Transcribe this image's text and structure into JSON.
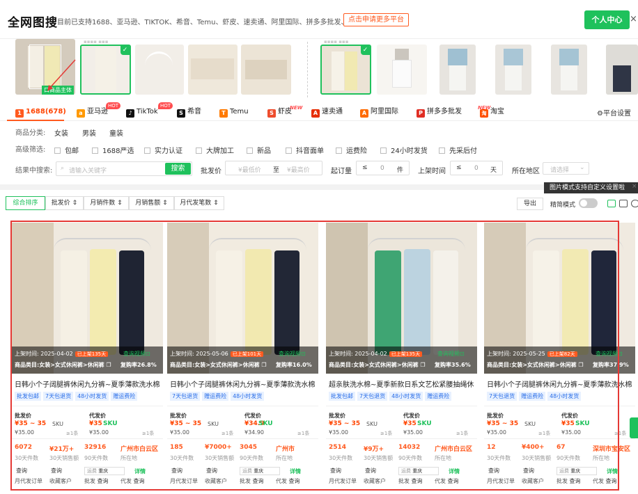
{
  "header": {
    "logo": "全网图搜",
    "supported": "目前已支持1688、亚马逊、TIKTOK、希音、Temu、虾皮、速卖通、阿里国际、拼多多批发、淘宝",
    "apply_label": "点击申请更多平台",
    "user_center": "个人中心",
    "close": "×",
    "main_badge": "口商品主体"
  },
  "platform_tabs": [
    {
      "label": "1688(678)",
      "color": "#ff5a1f",
      "glyph": "1"
    },
    {
      "label": "亚马逊",
      "color": "#ff9900",
      "glyph": "a",
      "badge": "HOT"
    },
    {
      "label": "TikTok",
      "color": "#111111",
      "glyph": "♪",
      "badge": "HOT"
    },
    {
      "label": "希音",
      "color": "#111111",
      "glyph": "S"
    },
    {
      "label": "Temu",
      "color": "#ff7a00",
      "glyph": "T"
    },
    {
      "label": "虾皮",
      "color": "#ee4d2d",
      "glyph": "S",
      "badge": "NEW"
    },
    {
      "label": "速卖通",
      "color": "#e62e04",
      "glyph": "A"
    },
    {
      "label": "阿里国际",
      "color": "#ff6a00",
      "glyph": "A"
    },
    {
      "label": "拼多多批发",
      "color": "#e02e24",
      "glyph": "P",
      "badge": "NEW"
    },
    {
      "label": "淘宝",
      "color": "#ff5000",
      "glyph": "淘"
    }
  ],
  "platform_settings": "平台设置",
  "filters": {
    "category_label": "商品分类:",
    "categories": [
      "女装",
      "男装",
      "童装"
    ],
    "advanced_label": "高级筛选:",
    "advanced": [
      "包邮",
      "1688严选",
      "实力认证",
      "大牌加工",
      "新品",
      "抖音面单",
      "运费险",
      "24小时发货",
      "先采后付"
    ],
    "search_in_label": "结果中搜索:",
    "search_placeholder": "请输入关键字",
    "search_button": "搜索",
    "wholesale_price_label": "批发价",
    "min_price_ph": "¥最低价",
    "to": "至",
    "max_price_ph": "¥最高价",
    "moq_label": "起订量",
    "le": "≤",
    "moq_value": "0",
    "moq_unit": "件",
    "shelf_time_label": "上架时间",
    "shelf_value": "0",
    "shelf_unit": "天",
    "region_label": "所在地区",
    "region_ph": "请选择"
  },
  "sort": {
    "buttons": [
      "综合排序",
      "批发价 ⇕",
      "月销件数 ⇕",
      "月销售额 ⇕",
      "月代发笔数 ⇕"
    ],
    "tip": "图片模式支持自定义设置啦",
    "tip_close": "×",
    "export": "导出",
    "simple_mode": "精简模式"
  },
  "card_labels": {
    "shelf_time": "上架时间:",
    "category": "商品类目:",
    "video": "查询视频⊡",
    "wholesale": "批发价",
    "dropship": "代发价",
    "sku": "SKU",
    "sales30": "30天件数",
    "sales30_amount": "30天销售额",
    "sales90": "90天件数",
    "location": "所在地",
    "query": "查询",
    "shipping": "运费",
    "details": "详情",
    "monthly_orders": "月代发订单",
    "collect": "收藏客户",
    "wholesale_short": "批发",
    "dropship_short": "代发",
    "query2": "查询"
  },
  "products": [
    {
      "date": "2025-04-02",
      "shelf_days": "已上架135天",
      "category": "女装>女式休闲裤>休闲裤",
      "repurchase": "复购率26.8%",
      "title": "日韩小个子阔腿裤休闲九分裤~夏季薄款洗水棉...",
      "tags": [
        "批发包邮",
        "7天包退货",
        "48小时发货",
        "赠运费险"
      ],
      "w_price": "¥35 ~ 35",
      "w_base": "¥35.00",
      "w_moq": "≥1条",
      "d_price": "¥35",
      "d_base": "¥35.00",
      "d_moq": "≥1条",
      "s30": "6072",
      "s30amt": "¥21万+",
      "s90": "32916",
      "loc": "广州市白云区",
      "ship_city": "重庆",
      "img_colors": [
        "#efe9df",
        "#d9cdb8",
        "#f5f0e4",
        "#f3ebb0",
        "#1f2433"
      ]
    },
    {
      "date": "2025-05-06",
      "shelf_days": "已上架101天",
      "category": "女装>女式休闲裤>休闲裤",
      "repurchase": "复购率16.0%",
      "title": "日韩小个子阔腿裤休闲九分裤~夏季薄款洗水棉...",
      "tags": [
        "7天包退货",
        "赠运费险",
        "48小时发货"
      ],
      "w_price": "¥35 ~ 35",
      "w_base": "¥35.00",
      "w_moq": "≥1条",
      "d_price": "¥34.9",
      "d_base": "¥34.90",
      "d_moq": "≥1条",
      "s30": "185",
      "s30amt": "¥7000+",
      "s90": "3045",
      "loc": "广州市",
      "ship_city": "重庆",
      "img_colors": [
        "#f1ebe0",
        "#d7ccb9",
        "#f6f1e6",
        "#f2e9b0",
        "#222736"
      ]
    },
    {
      "date": "2025-04-02",
      "shelf_days": "已上架135天",
      "category": "女装>女式休闲裤>休闲裤",
      "repurchase": "复购率35.6%",
      "title": "超亲肤洗水棉~夏季新款日系文艺松紧腰抽绳休...",
      "tags": [
        "批发包邮",
        "7天包退货",
        "48小时发货",
        "赠运费险"
      ],
      "w_price": "¥35 ~ 35",
      "w_base": "¥35.00",
      "w_moq": "≥1条",
      "d_price": "¥35",
      "d_base": "¥35.00",
      "d_moq": "≥1条",
      "s30": "2514",
      "s30amt": "¥9万+",
      "s90": "14032",
      "loc": "广州市白云区",
      "ship_city": "重庆",
      "img_colors": [
        "#ece6db",
        "#cfc4b0",
        "#3fa573",
        "#bcd3e0",
        "#f4f1ea"
      ]
    },
    {
      "date": "2025-05-25",
      "shelf_days": "已上架82天",
      "category": "女装>女式休闲裤>休闲裤",
      "repurchase": "复购率37.9%",
      "title": "日韩小个子阔腿裤休闲九分裤~夏季薄款洗水棉...",
      "tags": [
        "7天包退货",
        "赠运费险",
        "48小时发货"
      ],
      "w_price": "¥35 ~ 35",
      "w_base": "¥35.00",
      "w_moq": "≥1条",
      "d_price": "¥35",
      "d_base": "¥35.00",
      "d_moq": "≥1条",
      "s30": "12",
      "s30amt": "¥400+",
      "s90": "67",
      "loc": "深圳市宝安区",
      "ship_city": "重庆",
      "img_colors": [
        "#f0eae0",
        "#d6cbb8",
        "#f6f2e8",
        "#f2eab3",
        "#20263a"
      ]
    }
  ],
  "colors": {
    "green": "#1fc15c",
    "orange": "#ff5a1f",
    "red_box": "#e53935"
  }
}
